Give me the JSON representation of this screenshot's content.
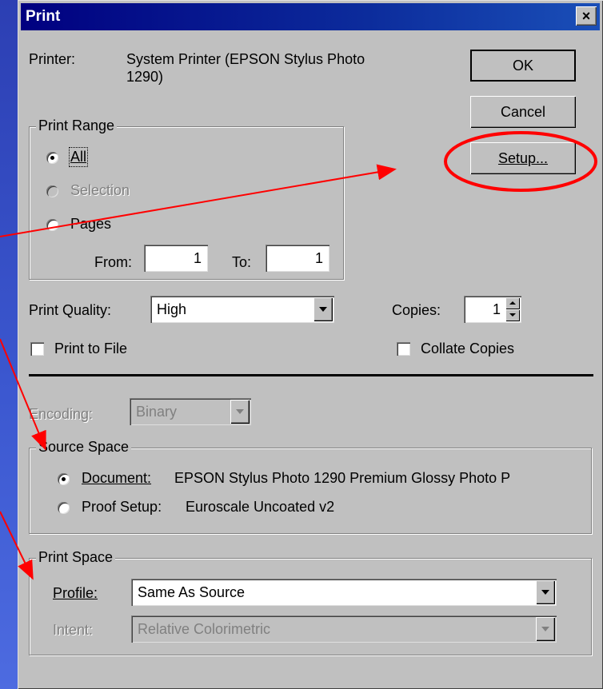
{
  "window": {
    "title": "Print",
    "close_glyph": "×"
  },
  "printer": {
    "label": "Printer:",
    "name_line1": "System Printer (EPSON Stylus Photo",
    "name_line2": "1290)"
  },
  "buttons": {
    "ok": "OK",
    "cancel": "Cancel",
    "setup": "Setup..."
  },
  "print_range": {
    "title": "Print Range",
    "options": {
      "all": "All",
      "selection": "Selection",
      "pages": "Pages"
    },
    "selected": "All",
    "from_label": "From:",
    "from_value": "1",
    "to_label": "To:",
    "to_value": "1"
  },
  "quality": {
    "label": "Print Quality:",
    "value": "High"
  },
  "copies": {
    "label": "Copies:",
    "value": "1"
  },
  "print_to_file": {
    "label": "Print to File",
    "checked": false
  },
  "collate": {
    "label": "Collate Copies",
    "checked": false
  },
  "encoding": {
    "label": "Encoding:",
    "value": "Binary"
  },
  "source_space": {
    "title": "Source Space",
    "document_label": "Document:",
    "document_value": "EPSON Stylus Photo 1290 Premium Glossy Photo P",
    "proof_label": "Proof Setup:",
    "proof_value": "Euroscale Uncoated v2",
    "selected": "Document"
  },
  "print_space": {
    "title": "Print Space",
    "profile_label": "Profile:",
    "profile_value": "Same As Source",
    "intent_label": "Intent:",
    "intent_value": "Relative Colorimetric"
  },
  "colors": {
    "annotation": "#ff0000",
    "title_bar": "#000080",
    "dialog": "#c0c0c0"
  }
}
